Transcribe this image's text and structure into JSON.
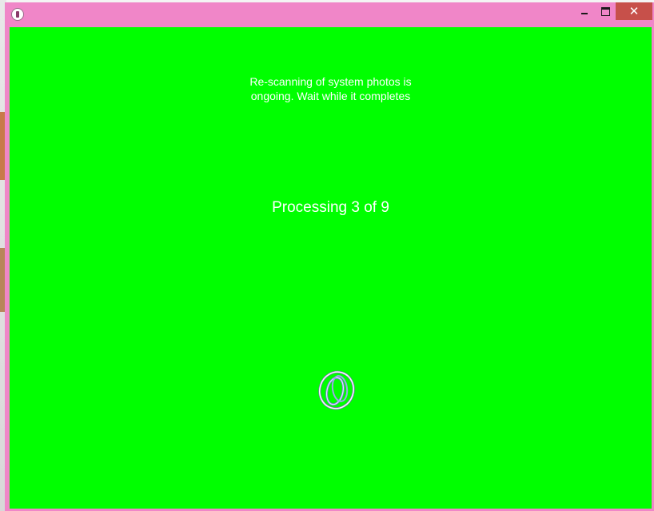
{
  "window": {
    "title": "",
    "controls": {
      "minimize_icon": "minimize-icon",
      "maximize_icon": "maximize-icon",
      "close_icon": "close-icon",
      "close_glyph": "✕"
    }
  },
  "colors": {
    "titlebar": "#f086c8",
    "client_background": "#00ff00",
    "close_button": "#c7504a",
    "text": "#ffffff"
  },
  "main": {
    "message_line1": "Re-scanning of system photos is",
    "message_line2": "ongoing. Wait while it completes",
    "progress": "Processing 3 of 9",
    "spinner_icon": "loading-spinner-icon"
  }
}
